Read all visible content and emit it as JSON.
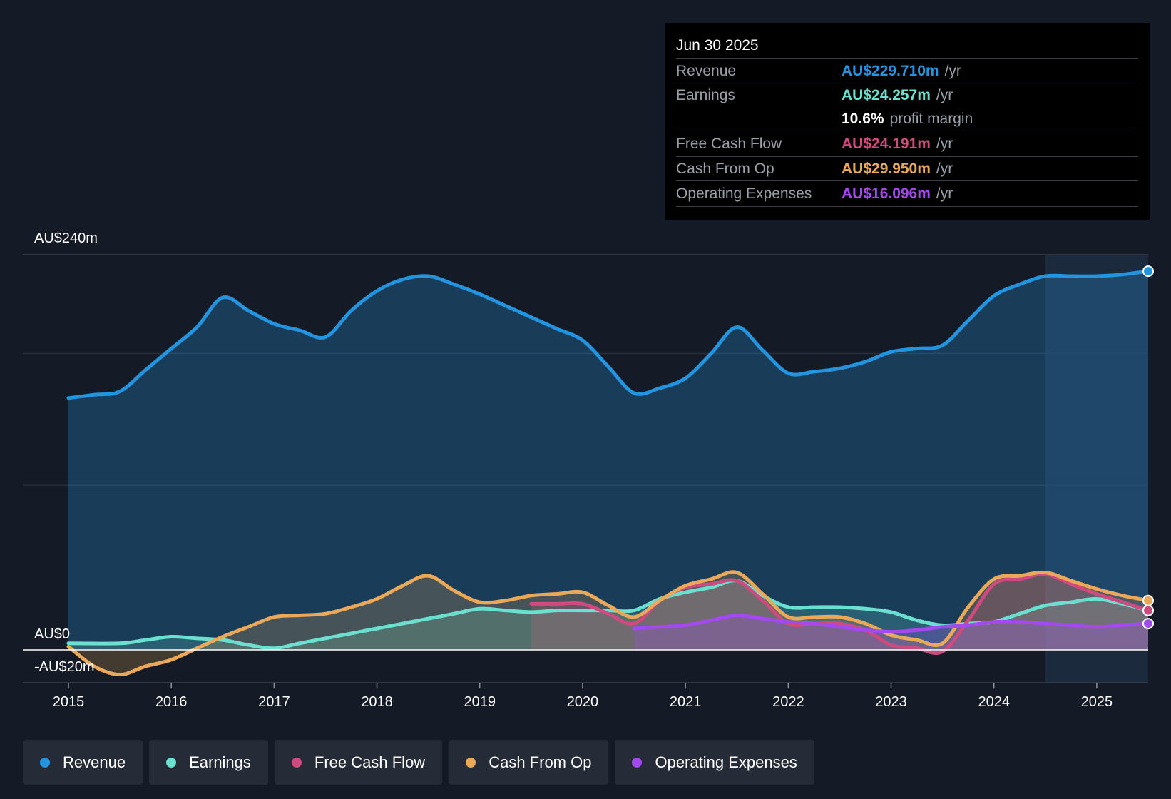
{
  "colors": {
    "background": "#151b26",
    "revenue": "#2394df",
    "earnings": "#6ae0d0",
    "free_cash_flow": "#cf4a7e",
    "cash_from_op": "#eaa858",
    "operating_expenses": "#a349ef"
  },
  "tooltip": {
    "date": "Jun 30 2025",
    "rows": [
      {
        "label": "Revenue",
        "value": "AU$229.710m",
        "unit": "/yr",
        "color": "#2394df"
      },
      {
        "label": "Earnings",
        "value": "AU$24.257m",
        "unit": "/yr",
        "color": "#6ae0d0"
      },
      {
        "label": "",
        "value": "10.6%",
        "unit": "profit margin",
        "color": "#ffffff"
      },
      {
        "label": "Free Cash Flow",
        "value": "AU$24.191m",
        "unit": "/yr",
        "color": "#cf4a7e"
      },
      {
        "label": "Cash From Op",
        "value": "AU$29.950m",
        "unit": "/yr",
        "color": "#eaa858"
      },
      {
        "label": "Operating Expenses",
        "value": "AU$16.096m",
        "unit": "/yr",
        "color": "#a349ef"
      }
    ]
  },
  "legend": [
    {
      "label": "Revenue",
      "color": "#2394df"
    },
    {
      "label": "Earnings",
      "color": "#6ae0d0"
    },
    {
      "label": "Free Cash Flow",
      "color": "#cf4a7e"
    },
    {
      "label": "Cash From Op",
      "color": "#eaa858"
    },
    {
      "label": "Operating Expenses",
      "color": "#a349ef"
    }
  ],
  "chart_data": {
    "type": "area",
    "title": "",
    "xlabel": "",
    "ylabel": "",
    "y_tick_labels": [
      "AU$240m",
      "AU$0",
      "-AU$20m"
    ],
    "ylim": [
      -20,
      240
    ],
    "xlim": [
      2015,
      2025.5
    ],
    "x_ticks": [
      2015,
      2016,
      2017,
      2018,
      2019,
      2020,
      2021,
      2022,
      2023,
      2024,
      2025
    ],
    "x_tick_labels": [
      "2015",
      "2016",
      "2017",
      "2018",
      "2019",
      "2020",
      "2021",
      "2022",
      "2023",
      "2024",
      "2025"
    ],
    "grid": true,
    "highlight_from": 2024.5,
    "series": [
      {
        "name": "Revenue",
        "key": "revenue",
        "color": "#2394df",
        "x": [
          2015,
          2015.25,
          2015.5,
          2015.75,
          2016,
          2016.25,
          2016.5,
          2016.75,
          2017,
          2017.25,
          2017.5,
          2017.75,
          2018,
          2018.25,
          2018.5,
          2018.75,
          2019,
          2019.25,
          2019.5,
          2019.75,
          2020,
          2020.25,
          2020.5,
          2020.75,
          2021,
          2021.25,
          2021.5,
          2021.75,
          2022,
          2022.25,
          2022.5,
          2022.75,
          2023,
          2023.25,
          2023.5,
          2023.75,
          2024,
          2024.25,
          2024.5,
          2024.75,
          2025,
          2025.25,
          2025.5
        ],
        "y": [
          153,
          155,
          157,
          170,
          183,
          196,
          214,
          206,
          198,
          194,
          190,
          206,
          218,
          225,
          227,
          222,
          216,
          209,
          202,
          195,
          188,
          172,
          156,
          159,
          165,
          180,
          196,
          182,
          168,
          169,
          171,
          175,
          181,
          183,
          185,
          200,
          215,
          222,
          227,
          227,
          227,
          228,
          230
        ]
      },
      {
        "name": "Earnings",
        "key": "earnings",
        "color": "#6ae0d0",
        "x": [
          2015,
          2015.5,
          2015.75,
          2016,
          2016.25,
          2016.5,
          2016.75,
          2017,
          2017.25,
          2017.5,
          2017.75,
          2018,
          2018.25,
          2018.5,
          2018.75,
          2019,
          2019.25,
          2019.5,
          2019.75,
          2020,
          2020.25,
          2020.5,
          2020.75,
          2021,
          2021.25,
          2021.5,
          2021.75,
          2022,
          2022.25,
          2022.5,
          2022.75,
          2023,
          2023.25,
          2023.5,
          2023.75,
          2024,
          2024.25,
          2024.5,
          2024.75,
          2025,
          2025.25,
          2025.5
        ],
        "y": [
          4,
          4,
          6,
          8,
          7,
          6,
          3,
          1,
          4,
          7,
          10,
          13,
          16,
          19,
          22,
          25,
          24,
          23,
          24,
          24,
          24,
          24,
          31,
          35,
          38,
          42,
          33,
          26,
          26,
          26,
          25,
          23,
          18,
          15,
          16,
          17,
          22,
          27,
          29,
          31,
          28,
          24
        ]
      },
      {
        "name": "Free Cash Flow",
        "key": "free_cash_flow",
        "color": "#cf4a7e",
        "x": [
          2019.5,
          2019.75,
          2020,
          2020.25,
          2020.5,
          2020.75,
          2021,
          2021.25,
          2021.5,
          2021.75,
          2022,
          2022.25,
          2022.5,
          2022.75,
          2023,
          2023.25,
          2023.5,
          2023.75,
          2024,
          2024.25,
          2024.5,
          2024.75,
          2025,
          2025.25,
          2025.5
        ],
        "y": [
          28,
          28,
          28,
          22,
          16,
          30,
          38,
          40,
          42,
          30,
          16,
          16,
          16,
          12,
          3,
          1,
          -1,
          18,
          40,
          43,
          46,
          40,
          34,
          29,
          24
        ]
      },
      {
        "name": "Cash From Op",
        "key": "cash_from_op",
        "color": "#eaa858",
        "x": [
          2015,
          2015.25,
          2015.5,
          2015.75,
          2016,
          2016.25,
          2016.5,
          2016.75,
          2017,
          2017.25,
          2017.5,
          2017.75,
          2018,
          2018.25,
          2018.5,
          2018.75,
          2019,
          2019.25,
          2019.5,
          2019.75,
          2020,
          2020.25,
          2020.5,
          2020.75,
          2021,
          2021.25,
          2021.5,
          2021.75,
          2022,
          2022.25,
          2022.5,
          2022.75,
          2023,
          2023.25,
          2023.5,
          2023.75,
          2024,
          2024.25,
          2024.5,
          2024.75,
          2025,
          2025.25,
          2025.5
        ],
        "y": [
          2,
          -10,
          -15,
          -10,
          -6,
          1,
          8,
          14,
          20,
          21,
          22,
          26,
          31,
          39,
          45,
          36,
          29,
          30,
          33,
          34,
          35,
          27,
          20,
          30,
          39,
          43,
          47,
          34,
          20,
          20,
          20,
          16,
          9,
          6,
          4,
          26,
          43,
          45,
          47,
          42,
          37,
          33,
          30
        ]
      },
      {
        "name": "Operating Expenses",
        "key": "operating_expenses",
        "color": "#a349ef",
        "x": [
          2020.5,
          2020.75,
          2021,
          2021.25,
          2021.5,
          2021.75,
          2022,
          2022.25,
          2022.5,
          2022.75,
          2023,
          2023.25,
          2023.5,
          2023.75,
          2024,
          2024.25,
          2024.5,
          2024.75,
          2025,
          2025.25,
          2025.5
        ],
        "y": [
          13,
          14,
          15,
          18,
          21,
          19,
          17,
          16,
          14,
          12,
          11,
          12,
          14,
          15,
          17,
          17,
          16,
          15,
          14,
          15,
          16
        ]
      }
    ]
  }
}
